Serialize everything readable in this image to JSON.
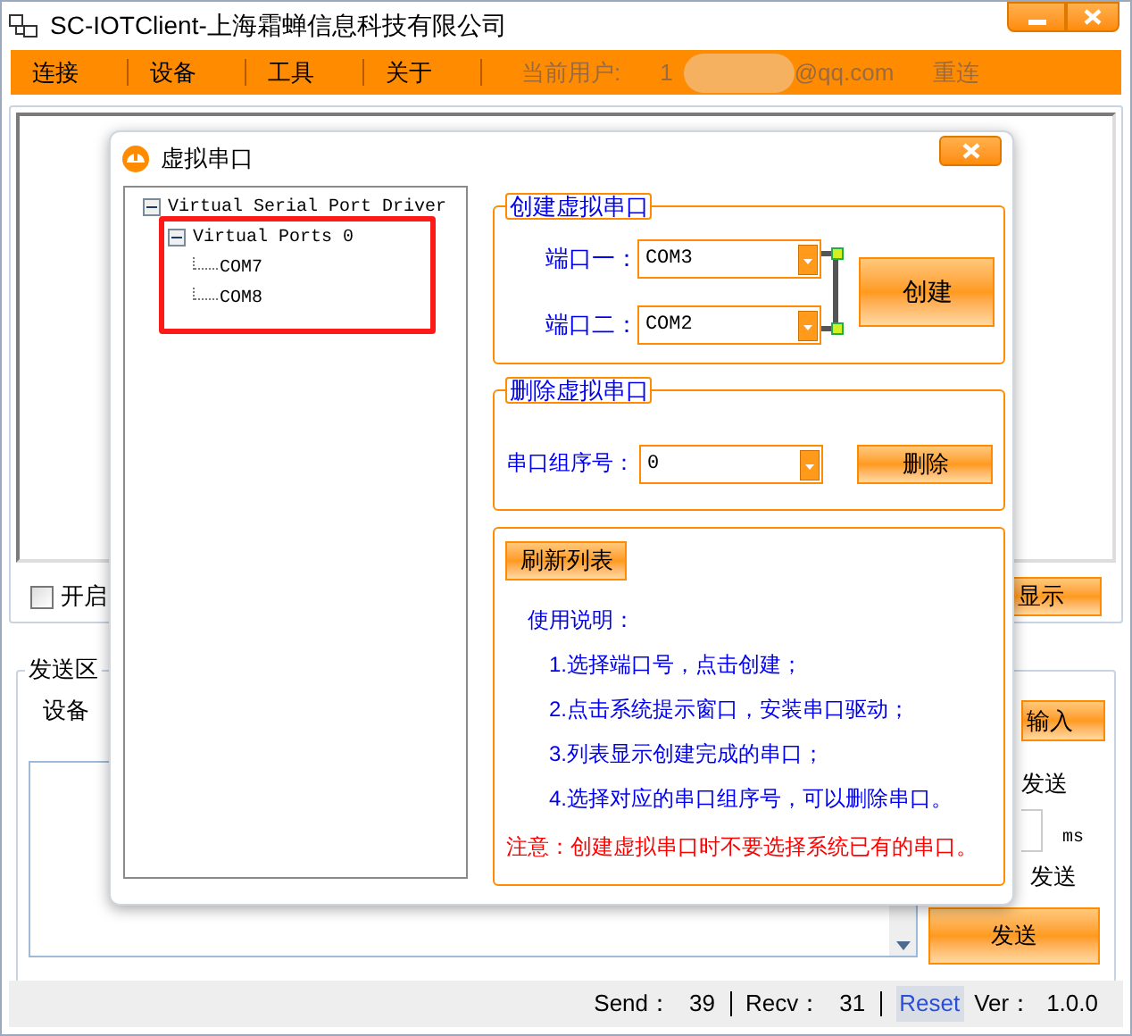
{
  "window": {
    "title": "SC-IOTClient-上海霜蝉信息科技有限公司"
  },
  "menu": {
    "items": [
      "连接",
      "设备",
      "工具",
      "关于"
    ],
    "user_label": "当前用户:",
    "user_prefix": "1",
    "user_suffix": "@qq.com",
    "reconnect": "重连"
  },
  "receive_options": {
    "checkbox": {
      "label": "开启",
      "checked": false
    },
    "show_button": "显示"
  },
  "send_area": {
    "title": "发送区",
    "device_list_label": "设备",
    "input_button": "输入",
    "send_option_label": "发送",
    "interval_unit": "ms",
    "send_option_label_2": "发送",
    "send_button": "发送"
  },
  "status_bar": {
    "send_label": "Send：",
    "send_count": "39",
    "recv_label": "Recv：",
    "recv_count": "31",
    "reset": "Reset",
    "version_label": "Ver：",
    "version": "1.0.0"
  },
  "dialog": {
    "title": "虚拟串口",
    "tree": [
      {
        "label": "Virtual Serial Port Driver",
        "expanded": true,
        "children": [
          {
            "label": "Virtual Ports 0",
            "expanded": true,
            "children": [
              {
                "label": "COM7"
              },
              {
                "label": "COM8"
              }
            ]
          }
        ]
      }
    ],
    "create_group": {
      "title": "创建虚拟串口",
      "port1_label": "端口一：",
      "port1_value": "COM3",
      "port2_label": "端口二：",
      "port2_value": "COM2",
      "button": "创建"
    },
    "delete_group": {
      "title": "删除虚拟串口",
      "index_label": "串口组序号：",
      "index_value": "0",
      "button": "删除"
    },
    "help_group": {
      "refresh_button": "刷新列表",
      "heading": "使用说明：",
      "steps": [
        "1.选择端口号，点击创建；",
        "2.点击系统提示窗口，安装串口驱动；",
        "3.列表显示创建完成的串口；",
        "4.选择对应的串口组序号，可以删除串口。"
      ],
      "note": "注意：创建虚拟串口时不要选择系统已有的串口。"
    }
  }
}
